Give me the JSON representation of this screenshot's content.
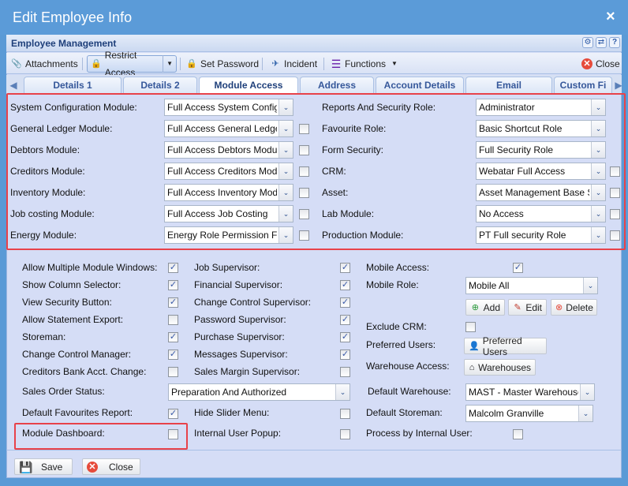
{
  "window": {
    "title": "Edit Employee Info",
    "close_icon": "×"
  },
  "header": {
    "title": "Employee Management",
    "icons": [
      "gear-icon",
      "refresh-icon",
      "help-icon"
    ],
    "help": "?",
    "gear": "⚙",
    "refresh": "⇄"
  },
  "toolbar": {
    "attachments": "Attachments",
    "restrict_access": "Restrict Access",
    "set_password": "Set Password",
    "incident": "Incident",
    "functions": "Functions",
    "close": "Close"
  },
  "tabs": [
    "Details 1",
    "Details 2",
    "Module Access",
    "Address",
    "Account Details",
    "Email",
    "Custom Fi"
  ],
  "active_tab": "Module Access",
  "modules_left": [
    {
      "label": "System Configuration Module:",
      "value": "Full Access System Config",
      "checkbox": null
    },
    {
      "label": "General Ledger Module:",
      "value": "Full Access General Ledger",
      "checkbox": false
    },
    {
      "label": "Debtors Module:",
      "value": "Full Access Debtors Module",
      "checkbox": false
    },
    {
      "label": "Creditors Module:",
      "value": "Full Access Creditors Module",
      "checkbox": false
    },
    {
      "label": "Inventory Module:",
      "value": "Full Access Inventory Module",
      "checkbox": false
    },
    {
      "label": "Job costing Module:",
      "value": "Full Access Job Costing",
      "checkbox": false
    },
    {
      "label": "Energy Module:",
      "value": "Energy Role Permission Full",
      "checkbox": false
    }
  ],
  "modules_right": [
    {
      "label": "Reports And Security Role:",
      "value": "Administrator",
      "checkbox": null
    },
    {
      "label": "Favourite Role:",
      "value": "Basic Shortcut Role",
      "checkbox": null
    },
    {
      "label": "Form Security:",
      "value": "Full Security Role",
      "checkbox": null
    },
    {
      "label": "CRM:",
      "value": "Webatar Full Access",
      "checkbox": false
    },
    {
      "label": "Asset:",
      "value": "Asset Management Base Security",
      "checkbox": false
    },
    {
      "label": "Lab Module:",
      "value": "No Access",
      "checkbox": false
    },
    {
      "label": "Production Module:",
      "value": "PT Full security Role",
      "checkbox": false
    }
  ],
  "options_col1": [
    {
      "label": "Allow Multiple Module Windows:",
      "checked": true
    },
    {
      "label": "Show Column Selector:",
      "checked": true
    },
    {
      "label": "View Security Button:",
      "checked": true
    },
    {
      "label": "Allow Statement Export:",
      "checked": false
    },
    {
      "label": "Storeman:",
      "checked": true
    },
    {
      "label": "Change Control Manager:",
      "checked": true
    },
    {
      "label": "Creditors Bank Acct. Change:",
      "checked": false
    }
  ],
  "options_col2": [
    {
      "label": "Job Supervisor:",
      "checked": true
    },
    {
      "label": "Financial Supervisor:",
      "checked": true
    },
    {
      "label": "Change Control Supervisor:",
      "checked": true
    },
    {
      "label": "Password Supervisor:",
      "checked": true
    },
    {
      "label": "Purchase Supervisor:",
      "checked": true
    },
    {
      "label": "Messages Supervisor:",
      "checked": true
    },
    {
      "label": "Sales Margin Supervisor:",
      "checked": false
    }
  ],
  "mobile": {
    "access_label": "Mobile Access:",
    "access_checked": true,
    "role_label": "Mobile Role:",
    "role_value": "Mobile All",
    "add": "Add",
    "edit": "Edit",
    "delete": "Delete"
  },
  "exclude_crm": {
    "label": "Exclude CRM:",
    "checked": false
  },
  "preferred_users": {
    "label": "Preferred Users:",
    "button": "Preferred Users"
  },
  "warehouse_access": {
    "label": "Warehouse Access:",
    "button": "Warehouses"
  },
  "sales_order_status": {
    "label": "Sales Order Status:",
    "value": "Preparation And Authorized"
  },
  "default_warehouse": {
    "label": "Default Warehouse:",
    "value": "MAST - Master Warehouse"
  },
  "default_favourites_report": {
    "label": "Default Favourites Report:",
    "checked": true
  },
  "hide_slider_menu": {
    "label": "Hide Slider Menu:",
    "checked": false
  },
  "default_storeman": {
    "label": "Default Storeman:",
    "value": "Malcolm Granville"
  },
  "module_dashboard": {
    "label": "Module Dashboard:",
    "checked": false
  },
  "internal_user_popup": {
    "label": "Internal User Popup:",
    "checked": false
  },
  "process_by_internal_user": {
    "label": "Process by Internal User:",
    "checked": false
  },
  "footer": {
    "save": "Save",
    "close": "Close"
  },
  "colors": {
    "highlight": "#e8424a",
    "panel": "#d5ddf6",
    "titlebar": "#5b9bd8"
  }
}
